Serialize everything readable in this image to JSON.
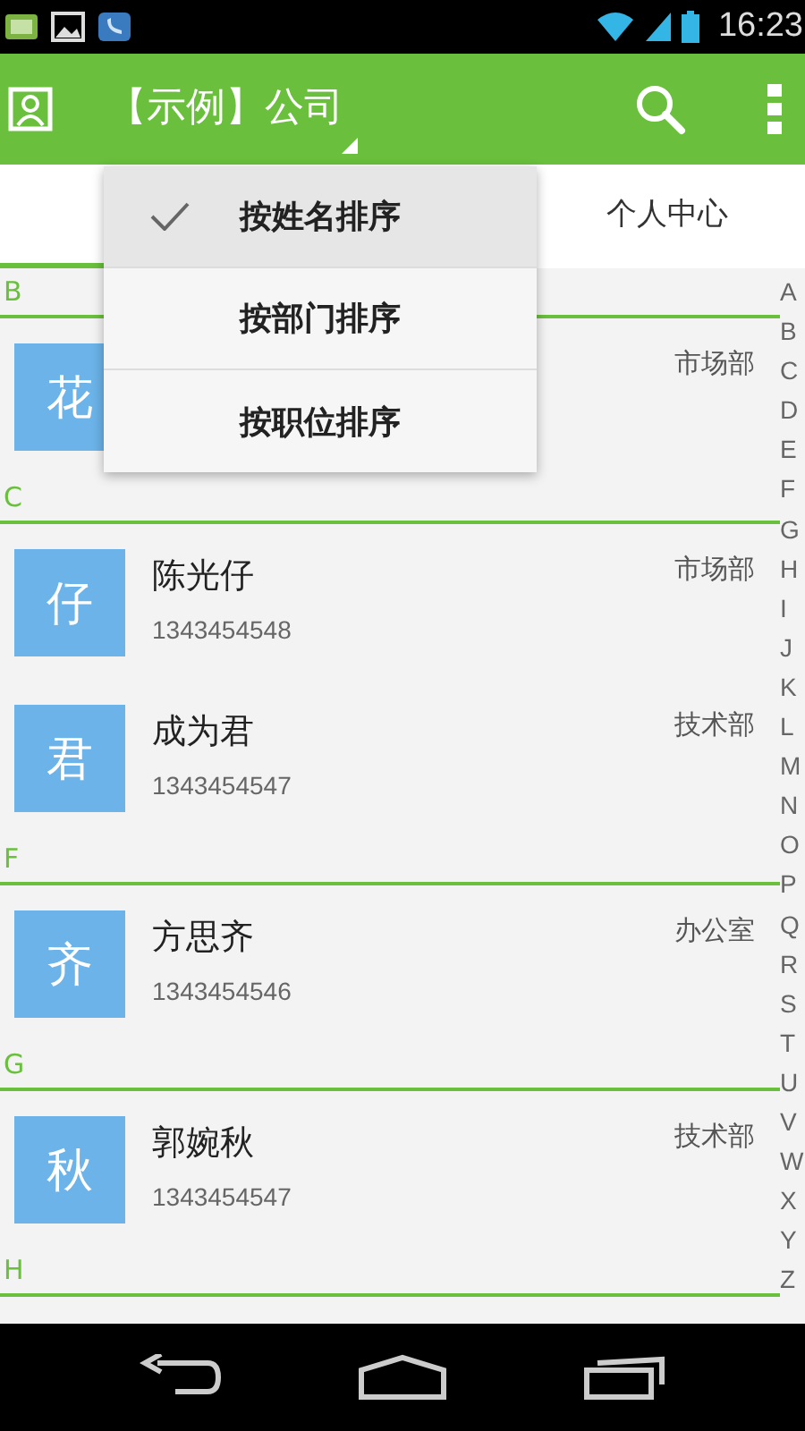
{
  "status_bar": {
    "time": "16:23"
  },
  "app_bar": {
    "title": "【示例】公司"
  },
  "tabs": [
    {
      "selected": true
    },
    {
      "label": "个人中心",
      "selected": false
    }
  ],
  "sort_menu": [
    {
      "label": "按姓名排序",
      "selected": true
    },
    {
      "label": "按部门排序",
      "selected": false
    },
    {
      "label": "按职位排序",
      "selected": false
    }
  ],
  "sections": [
    {
      "letter": "B",
      "contacts": [
        {
          "avatar": "花",
          "department": "市场部"
        }
      ]
    },
    {
      "letter": "C",
      "contacts": [
        {
          "avatar": "仔",
          "name": "陈光仔",
          "phone": "1343454548",
          "department": "市场部"
        },
        {
          "avatar": "君",
          "name": "成为君",
          "phone": "1343454547",
          "department": "技术部"
        }
      ]
    },
    {
      "letter": "F",
      "contacts": [
        {
          "avatar": "齐",
          "name": "方思齐",
          "phone": "1343454546",
          "department": "办公室"
        }
      ]
    },
    {
      "letter": "G",
      "contacts": [
        {
          "avatar": "秋",
          "name": "郭婉秋",
          "phone": "1343454547",
          "department": "技术部"
        }
      ]
    },
    {
      "letter": "H"
    }
  ],
  "index_letters": [
    "A",
    "B",
    "C",
    "D",
    "E",
    "F",
    "G",
    "H",
    "I",
    "J",
    "K",
    "L",
    "M",
    "N",
    "O",
    "P",
    "Q",
    "R",
    "S",
    "T",
    "U",
    "V",
    "W",
    "X",
    "Y",
    "Z"
  ]
}
